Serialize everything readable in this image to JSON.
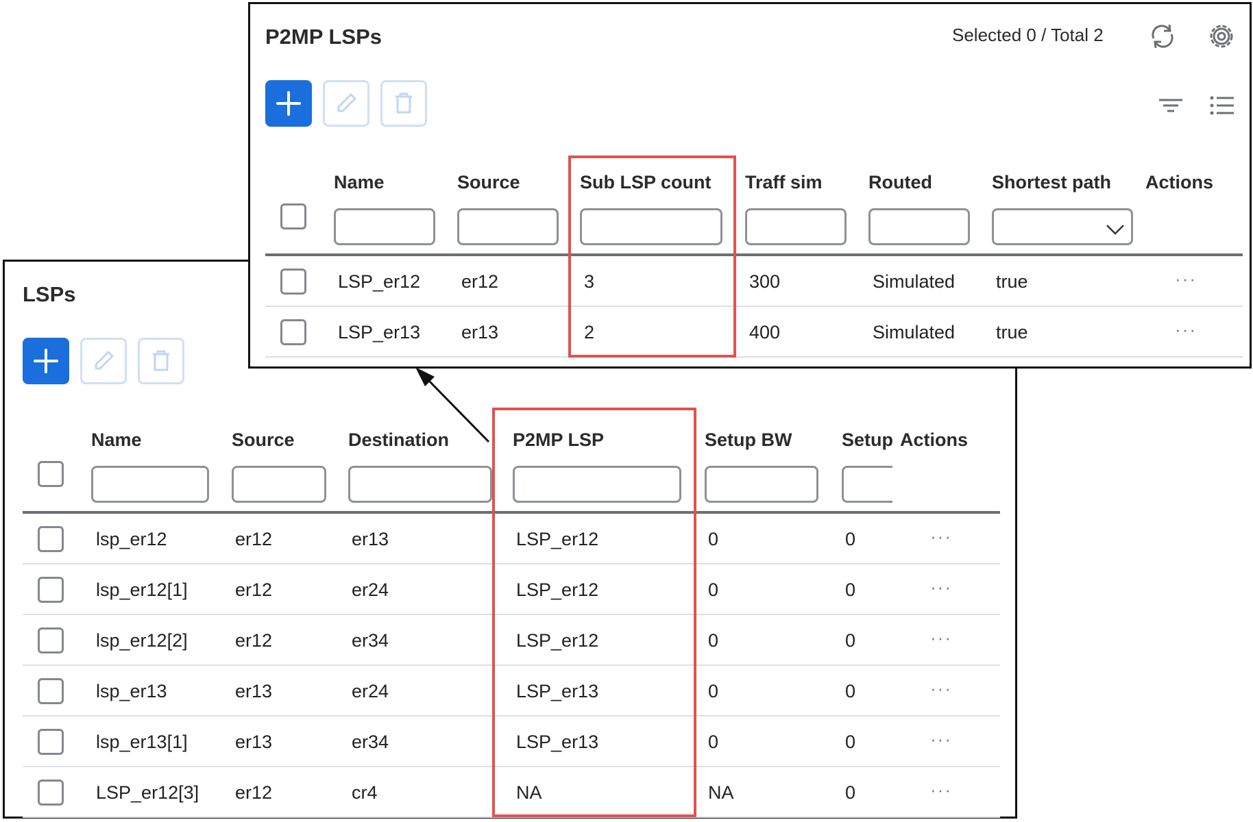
{
  "lsps": {
    "title": "LSPs",
    "columns": [
      "Name",
      "Source",
      "Destination",
      "P2MP LSP",
      "Setup BW",
      "Setup",
      "Actions"
    ],
    "rows": [
      {
        "name": "lsp_er12",
        "source": "er12",
        "destination": "er13",
        "p2mp": "LSP_er12",
        "setup_bw": "0",
        "setup": "0"
      },
      {
        "name": "lsp_er12[1]",
        "source": "er12",
        "destination": "er24",
        "p2mp": "LSP_er12",
        "setup_bw": "0",
        "setup": "0"
      },
      {
        "name": "lsp_er12[2]",
        "source": "er12",
        "destination": "er34",
        "p2mp": "LSP_er12",
        "setup_bw": "0",
        "setup": "0"
      },
      {
        "name": "lsp_er13",
        "source": "er13",
        "destination": "er24",
        "p2mp": "LSP_er13",
        "setup_bw": "0",
        "setup": "0"
      },
      {
        "name": "lsp_er13[1]",
        "source": "er13",
        "destination": "er34",
        "p2mp": "LSP_er13",
        "setup_bw": "0",
        "setup": "0"
      },
      {
        "name": "LSP_er12[3]",
        "source": "er12",
        "destination": "cr4",
        "p2mp": "NA",
        "setup_bw": "NA",
        "setup": "0"
      }
    ],
    "actions_glyph": "···"
  },
  "p2mp": {
    "title": "P2MP LSPs",
    "selection_status": "Selected 0 / Total 2",
    "columns": [
      "Name",
      "Source",
      "Sub LSP count",
      "Traff sim",
      "Routed",
      "Shortest path",
      "Actions"
    ],
    "rows": [
      {
        "name": "LSP_er12",
        "source": "er12",
        "sub_lsp_count": "3",
        "traff_sim": "300",
        "routed": "Simulated",
        "shortest_path": "true"
      },
      {
        "name": "LSP_er13",
        "source": "er13",
        "sub_lsp_count": "2",
        "traff_sim": "400",
        "routed": "Simulated",
        "shortest_path": "true"
      }
    ],
    "actions_glyph": "···"
  },
  "icons": {
    "add": "plus-icon",
    "edit": "pencil-icon",
    "delete": "trash-icon",
    "refresh": "refresh-icon",
    "settings": "gear-icon",
    "filter": "filter-icon",
    "columns": "list-icon",
    "dropdown": "chevron-down-icon"
  },
  "colors": {
    "primary": "#1a6fdc",
    "highlight": "#e0534f",
    "disabled_border": "#cfe0f6"
  }
}
